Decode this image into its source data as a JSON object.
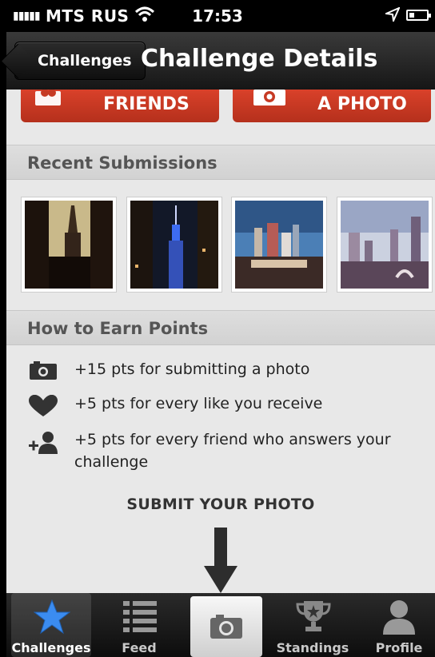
{
  "status": {
    "carrier": "MTS RUS",
    "time": "17:53"
  },
  "nav": {
    "back_label": "Challenges",
    "title": "Challenge Details"
  },
  "actions": {
    "challenge_friends_label": "FRIENDS",
    "submit_photo_label": "A PHOTO"
  },
  "recent": {
    "heading": "Recent Submissions",
    "thumbnails": [
      "skyscraper-dusk",
      "empire-state-night",
      "las-vegas-skyline",
      "city-park-skyline"
    ]
  },
  "points": {
    "heading": "How to Earn Points",
    "items": [
      {
        "icon": "camera-icon",
        "text": "+15 pts for submitting a photo"
      },
      {
        "icon": "heart-icon",
        "text": "+5 pts for every like you receive"
      },
      {
        "icon": "add-friend-icon",
        "text": "+5 pts for every friend who answers your challenge"
      }
    ]
  },
  "submit_cta": "SUBMIT YOUR PHOTO",
  "tabs": [
    {
      "label": "Challenges",
      "icon": "star-icon",
      "active": true
    },
    {
      "label": "Feed",
      "icon": "list-icon",
      "active": false
    },
    {
      "label": "",
      "icon": "camera-icon",
      "active": false
    },
    {
      "label": "Standings",
      "icon": "trophy-icon",
      "active": false
    },
    {
      "label": "Profile",
      "icon": "person-icon",
      "active": false
    }
  ],
  "colors": {
    "accent_red": "#c63a24",
    "tab_star": "#3b8cf0"
  }
}
